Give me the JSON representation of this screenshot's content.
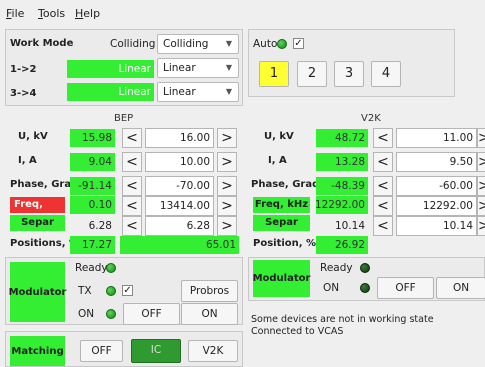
{
  "menu": {
    "file": "ile",
    "file_u": "F",
    "tools": "ools",
    "tools_u": "T",
    "help": "elp",
    "help_u": "H"
  },
  "work_mode": {
    "label": "Work Mode",
    "mode_text": "Colliding",
    "mode_combo": "Colliding",
    "row1_label": "1->2",
    "row1_value": "Linear",
    "row1_combo": "Linear",
    "row2_label": "3->4",
    "row2_value": "Linear",
    "row2_combo": "Linear"
  },
  "auto": {
    "label": "Auto",
    "checked": "✓",
    "buttons": [
      "1",
      "2",
      "3",
      "4"
    ],
    "active": "1"
  },
  "bep": {
    "title": "BEP",
    "rows": [
      {
        "label": "U, kV",
        "value": "15.98",
        "setpoint": "16.00"
      },
      {
        "label": "I, A",
        "value": "9.04",
        "setpoint": "10.00"
      },
      {
        "label": "Phase, Grad",
        "value": "-91.14",
        "setpoint": "-70.00"
      },
      {
        "label": "Freq, kHz",
        "value": "0.10",
        "setpoint": "13414.00"
      },
      {
        "label": "Separ",
        "value": "6.28",
        "setpoint": "6.28"
      }
    ],
    "positions_label": "Positions, %",
    "positions_value": "17.27",
    "positions_bar": "65.01",
    "modulator": {
      "label": "Modulator",
      "ready": "Ready",
      "tx": "TX",
      "tx_check": "✓",
      "probros": "Probros",
      "on": "ON",
      "off_btn": "OFF",
      "on_btn": "ON"
    },
    "matching": {
      "label": "Matching",
      "off": "OFF",
      "ic": "IC",
      "v2k": "V2K"
    }
  },
  "v2k": {
    "title": "V2K",
    "rows": [
      {
        "label": "U, kV",
        "value": "48.72",
        "setpoint": "11.00"
      },
      {
        "label": "I, A",
        "value": "13.28",
        "setpoint": "9.50"
      },
      {
        "label": "Phase, Grad",
        "value": "-48.39",
        "setpoint": "-60.00"
      },
      {
        "label": "Freq, kHz",
        "value": "12292.00",
        "setpoint": "12292.00"
      },
      {
        "label": "Separ",
        "value": "10.14",
        "setpoint": "10.14"
      }
    ],
    "position_label": "Position, %",
    "position_value": "26.92",
    "modulator": {
      "label": "Modulator",
      "ready": "Ready",
      "on": "ON",
      "off_btn": "OFF",
      "on_btn": "ON"
    }
  },
  "status": {
    "line1": "Some devices are not in working state",
    "line2": "Connected to VCAS"
  },
  "chevrons": {
    "left": "<",
    "right": ">"
  },
  "colors": {
    "green": "#33ee33",
    "red": "#ee3333",
    "led_on": "#2aa82a",
    "led_off": "#0b3a0b",
    "active_btn": "#ffff33"
  }
}
